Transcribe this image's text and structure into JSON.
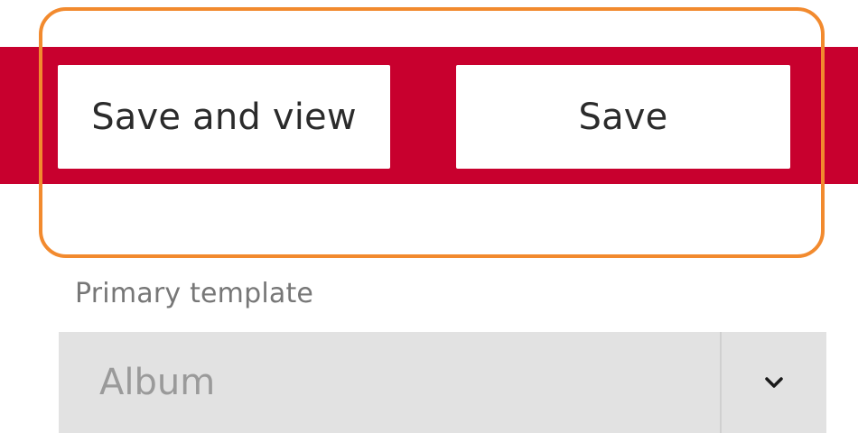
{
  "toolbar": {
    "save_and_view_label": "Save and view",
    "save_label": "Save"
  },
  "primary_template": {
    "label": "Primary template",
    "selected_value": "Album",
    "toggle_icon": "chevron-down-icon"
  },
  "colors": {
    "action_bar": "#c8002e",
    "highlight": "#f28a2e",
    "select_background": "#e2e2e2"
  }
}
